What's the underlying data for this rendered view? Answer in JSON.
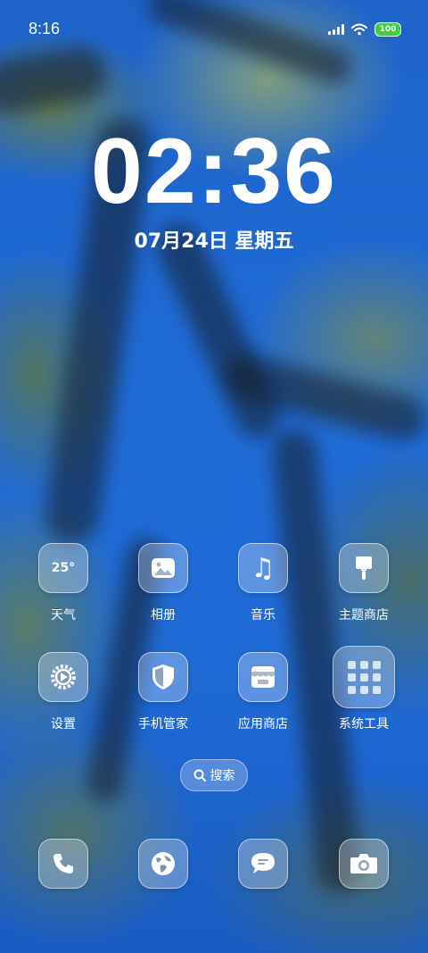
{
  "status_bar": {
    "time": "8:16",
    "battery": "100",
    "battery_color": "#3fcf45"
  },
  "lockclock": {
    "time": "02:36",
    "date": "07月24日 星期五"
  },
  "apps_row1": [
    {
      "label": "天气",
      "icon": "weather-icon",
      "icon_text": "25°"
    },
    {
      "label": "相册",
      "icon": "gallery-icon"
    },
    {
      "label": "音乐",
      "icon": "music-icon",
      "icon_text": "♫"
    },
    {
      "label": "主题商店",
      "icon": "theme-store-icon"
    }
  ],
  "apps_row2": [
    {
      "label": "设置",
      "icon": "settings-gear-icon"
    },
    {
      "label": "手机管家",
      "icon": "security-shield-icon"
    },
    {
      "label": "应用商店",
      "icon": "app-store-icon"
    },
    {
      "label": "系统工具",
      "icon": "system-tools-folder-icon"
    }
  ],
  "search": {
    "label": "搜索",
    "icon": "search-icon"
  },
  "dock": [
    {
      "icon": "phone-icon"
    },
    {
      "icon": "browser-globe-icon"
    },
    {
      "icon": "messages-icon"
    },
    {
      "icon": "camera-icon"
    }
  ]
}
